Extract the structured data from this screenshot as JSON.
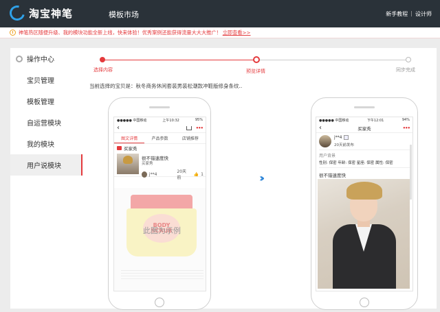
{
  "header": {
    "logo_text": "淘宝神笔",
    "nav_title": "模板市场",
    "right_links": [
      "新手教程",
      "设计师"
    ],
    "separator": "|"
  },
  "notice": {
    "text": "神笔热区随便升级、我的模块功能全新上线，快来体验！优秀案例还能获得流量大大大推广！",
    "link": "立即查看>>"
  },
  "sidebar": {
    "header": "操作中心",
    "items": [
      "宝贝管理",
      "模板管理",
      "自运营模块",
      "我的模块",
      "用户说模块"
    ],
    "active_index": 4
  },
  "steps": [
    {
      "label": "选择内容",
      "state": "done"
    },
    {
      "label": "预览详情",
      "state": "current"
    },
    {
      "label": "同步完成",
      "state": "pending"
    }
  ],
  "selected_item": "当前选择的宝贝是：秋冬商务休闲套装男装松潮款冲鞋版修身条纹..",
  "phone_left": {
    "status_left": "●●●●● 中国移动",
    "status_time": "上午10:32",
    "status_right": "95%",
    "tabs": [
      "图文详情",
      "产品参数",
      "店铺推荐"
    ],
    "buyer_show": "买家秀",
    "review_text": "很不错速度快",
    "review_sub": "买家秀",
    "reviewer": "j**4",
    "time": "20天前",
    "likes": "1",
    "jar_label": "BODY SCRUB",
    "watermark": "此图为示例"
  },
  "phone_right": {
    "status_left": "●●●●● 中国移动",
    "status_time": "下午12:01",
    "status_right": "94%",
    "title": "买家秀",
    "user": "j**4",
    "posted": "20天前发布",
    "user_section": "用户背景",
    "attrs": "性别: 保密   年龄: 保密   星座: 保密   属性: 保密",
    "review_title": "很不错速度快"
  },
  "colors": {
    "accent": "#e4393c",
    "header_bg": "#2a3239",
    "arrow": "#2f86d8"
  }
}
